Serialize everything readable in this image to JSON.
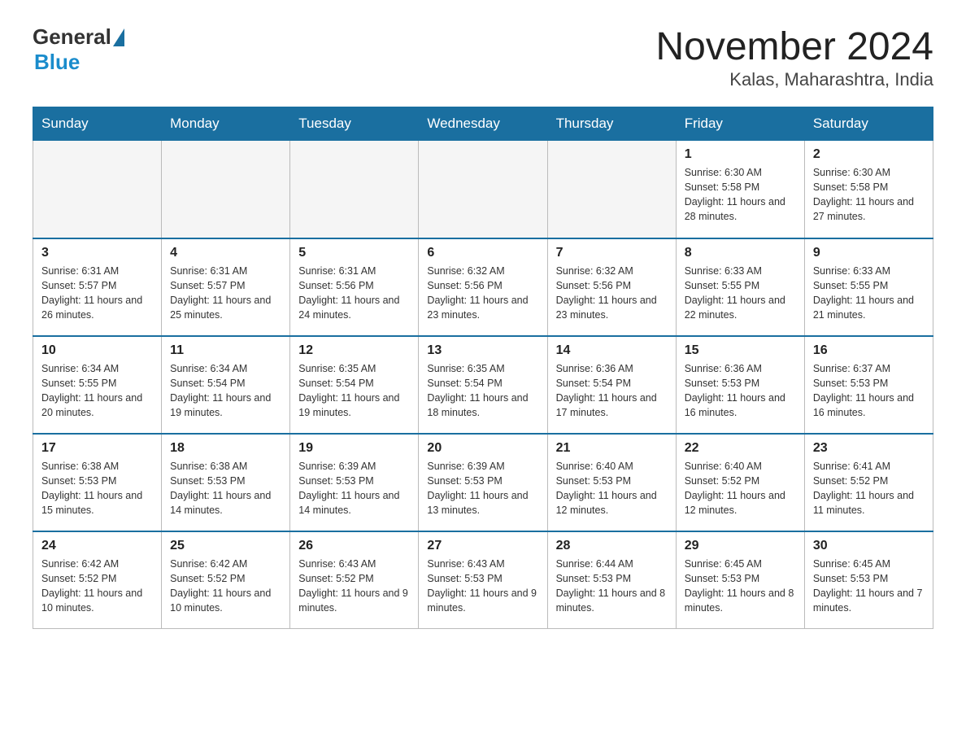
{
  "logo": {
    "general": "General",
    "blue": "Blue"
  },
  "title": "November 2024",
  "subtitle": "Kalas, Maharashtra, India",
  "weekdays": [
    "Sunday",
    "Monday",
    "Tuesday",
    "Wednesday",
    "Thursday",
    "Friday",
    "Saturday"
  ],
  "weeks": [
    [
      {
        "day": "",
        "empty": true
      },
      {
        "day": "",
        "empty": true
      },
      {
        "day": "",
        "empty": true
      },
      {
        "day": "",
        "empty": true
      },
      {
        "day": "",
        "empty": true
      },
      {
        "day": "1",
        "sunrise": "6:30 AM",
        "sunset": "5:58 PM",
        "daylight": "11 hours and 28 minutes."
      },
      {
        "day": "2",
        "sunrise": "6:30 AM",
        "sunset": "5:58 PM",
        "daylight": "11 hours and 27 minutes."
      }
    ],
    [
      {
        "day": "3",
        "sunrise": "6:31 AM",
        "sunset": "5:57 PM",
        "daylight": "11 hours and 26 minutes."
      },
      {
        "day": "4",
        "sunrise": "6:31 AM",
        "sunset": "5:57 PM",
        "daylight": "11 hours and 25 minutes."
      },
      {
        "day": "5",
        "sunrise": "6:31 AM",
        "sunset": "5:56 PM",
        "daylight": "11 hours and 24 minutes."
      },
      {
        "day": "6",
        "sunrise": "6:32 AM",
        "sunset": "5:56 PM",
        "daylight": "11 hours and 23 minutes."
      },
      {
        "day": "7",
        "sunrise": "6:32 AM",
        "sunset": "5:56 PM",
        "daylight": "11 hours and 23 minutes."
      },
      {
        "day": "8",
        "sunrise": "6:33 AM",
        "sunset": "5:55 PM",
        "daylight": "11 hours and 22 minutes."
      },
      {
        "day": "9",
        "sunrise": "6:33 AM",
        "sunset": "5:55 PM",
        "daylight": "11 hours and 21 minutes."
      }
    ],
    [
      {
        "day": "10",
        "sunrise": "6:34 AM",
        "sunset": "5:55 PM",
        "daylight": "11 hours and 20 minutes."
      },
      {
        "day": "11",
        "sunrise": "6:34 AM",
        "sunset": "5:54 PM",
        "daylight": "11 hours and 19 minutes."
      },
      {
        "day": "12",
        "sunrise": "6:35 AM",
        "sunset": "5:54 PM",
        "daylight": "11 hours and 19 minutes."
      },
      {
        "day": "13",
        "sunrise": "6:35 AM",
        "sunset": "5:54 PM",
        "daylight": "11 hours and 18 minutes."
      },
      {
        "day": "14",
        "sunrise": "6:36 AM",
        "sunset": "5:54 PM",
        "daylight": "11 hours and 17 minutes."
      },
      {
        "day": "15",
        "sunrise": "6:36 AM",
        "sunset": "5:53 PM",
        "daylight": "11 hours and 16 minutes."
      },
      {
        "day": "16",
        "sunrise": "6:37 AM",
        "sunset": "5:53 PM",
        "daylight": "11 hours and 16 minutes."
      }
    ],
    [
      {
        "day": "17",
        "sunrise": "6:38 AM",
        "sunset": "5:53 PM",
        "daylight": "11 hours and 15 minutes."
      },
      {
        "day": "18",
        "sunrise": "6:38 AM",
        "sunset": "5:53 PM",
        "daylight": "11 hours and 14 minutes."
      },
      {
        "day": "19",
        "sunrise": "6:39 AM",
        "sunset": "5:53 PM",
        "daylight": "11 hours and 14 minutes."
      },
      {
        "day": "20",
        "sunrise": "6:39 AM",
        "sunset": "5:53 PM",
        "daylight": "11 hours and 13 minutes."
      },
      {
        "day": "21",
        "sunrise": "6:40 AM",
        "sunset": "5:53 PM",
        "daylight": "11 hours and 12 minutes."
      },
      {
        "day": "22",
        "sunrise": "6:40 AM",
        "sunset": "5:52 PM",
        "daylight": "11 hours and 12 minutes."
      },
      {
        "day": "23",
        "sunrise": "6:41 AM",
        "sunset": "5:52 PM",
        "daylight": "11 hours and 11 minutes."
      }
    ],
    [
      {
        "day": "24",
        "sunrise": "6:42 AM",
        "sunset": "5:52 PM",
        "daylight": "11 hours and 10 minutes."
      },
      {
        "day": "25",
        "sunrise": "6:42 AM",
        "sunset": "5:52 PM",
        "daylight": "11 hours and 10 minutes."
      },
      {
        "day": "26",
        "sunrise": "6:43 AM",
        "sunset": "5:52 PM",
        "daylight": "11 hours and 9 minutes."
      },
      {
        "day": "27",
        "sunrise": "6:43 AM",
        "sunset": "5:53 PM",
        "daylight": "11 hours and 9 minutes."
      },
      {
        "day": "28",
        "sunrise": "6:44 AM",
        "sunset": "5:53 PM",
        "daylight": "11 hours and 8 minutes."
      },
      {
        "day": "29",
        "sunrise": "6:45 AM",
        "sunset": "5:53 PM",
        "daylight": "11 hours and 8 minutes."
      },
      {
        "day": "30",
        "sunrise": "6:45 AM",
        "sunset": "5:53 PM",
        "daylight": "11 hours and 7 minutes."
      }
    ]
  ],
  "labels": {
    "sunrise": "Sunrise:",
    "sunset": "Sunset:",
    "daylight": "Daylight:"
  }
}
